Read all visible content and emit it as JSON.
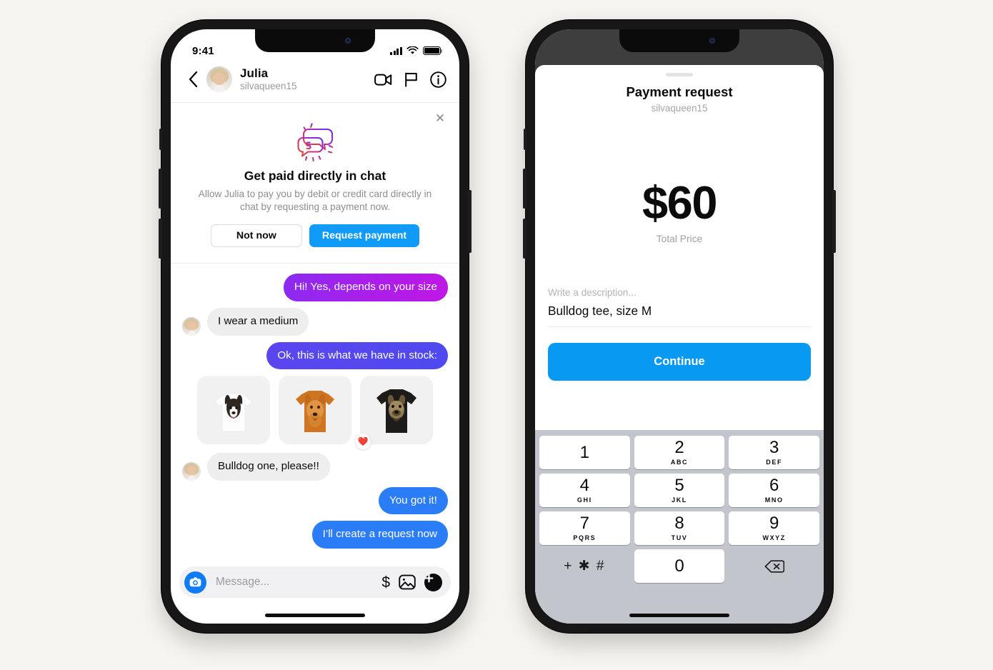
{
  "background_color": "#f7f5f1",
  "left_phone": {
    "status_bar": {
      "time": "9:41",
      "signal_icon": "cellular-bars-icon",
      "wifi_icon": "wifi-icon",
      "battery_icon": "battery-icon"
    },
    "chat_header": {
      "back_icon": "back-chevron-icon",
      "avatar": "contact-avatar",
      "name": "Julia",
      "handle": "silvaqueen15",
      "actions": [
        {
          "icon": "video-call-icon"
        },
        {
          "icon": "flag-icon"
        },
        {
          "icon": "info-icon"
        }
      ]
    },
    "promo": {
      "close_icon": "close-icon",
      "icon": "chat-bubbles-dollar-icon",
      "title": "Get paid directly in chat",
      "subtitle": "Allow Julia to pay you by debit or credit card directly in chat by requesting a payment now.",
      "secondary_button": "Not now",
      "primary_button": "Request payment",
      "primary_color": "#0f9bf7"
    },
    "messages": [
      {
        "side": "out",
        "text": "Hi! Yes, depends on your size",
        "style": "magenta"
      },
      {
        "side": "in",
        "text": "I wear a medium",
        "style": "grey",
        "avatar": true
      },
      {
        "side": "out",
        "text": "Ok, this is what we have in stock:",
        "style": "violet"
      }
    ],
    "gallery": {
      "name": "product-gallery",
      "items": [
        {
          "alt": "white t-shirt with border collie print",
          "shirt_color": "#ffffff",
          "reaction": null
        },
        {
          "alt": "orange t-shirt with golden retriever print",
          "shirt_color": "#d2771f",
          "reaction": null
        },
        {
          "alt": "black t-shirt with bulldog print",
          "shirt_color": "#1b1b1b",
          "reaction": "❤️"
        }
      ]
    },
    "messages_after": [
      {
        "side": "in",
        "text": "Bulldog one, please!!",
        "style": "grey",
        "avatar": true
      },
      {
        "side": "out",
        "text": "You got it!",
        "style": "blue"
      },
      {
        "side": "out",
        "text": "I’ll create a request now",
        "style": "blue"
      }
    ],
    "composer": {
      "camera_icon": "camera-icon",
      "placeholder": "Message...",
      "dollar_icon": "dollar-icon",
      "gallery_icon": "image-icon",
      "plus_icon": "plus-icon"
    }
  },
  "right_phone": {
    "overlay_color": "#3e3e3e",
    "sheet": {
      "grabber": "sheet-grabber",
      "title": "Payment request",
      "subtitle": "silvaqueen15",
      "amount": "$60",
      "amount_label": "Total Price",
      "description_placeholder": "Write a description...",
      "description_value": "Bulldog tee, size M",
      "continue_label": "Continue",
      "continue_color": "#089af3"
    },
    "keypad": {
      "keys": [
        {
          "num": "1",
          "sub": ""
        },
        {
          "num": "2",
          "sub": "ABC"
        },
        {
          "num": "3",
          "sub": "DEF"
        },
        {
          "num": "4",
          "sub": "GHI"
        },
        {
          "num": "5",
          "sub": "JKL"
        },
        {
          "num": "6",
          "sub": "MNO"
        },
        {
          "num": "7",
          "sub": "PQRS"
        },
        {
          "num": "8",
          "sub": "TUV"
        },
        {
          "num": "9",
          "sub": "WXYZ"
        }
      ],
      "symbols_key": "+ ✱ #",
      "zero_key": "0",
      "delete_icon": "backspace-icon"
    }
  }
}
